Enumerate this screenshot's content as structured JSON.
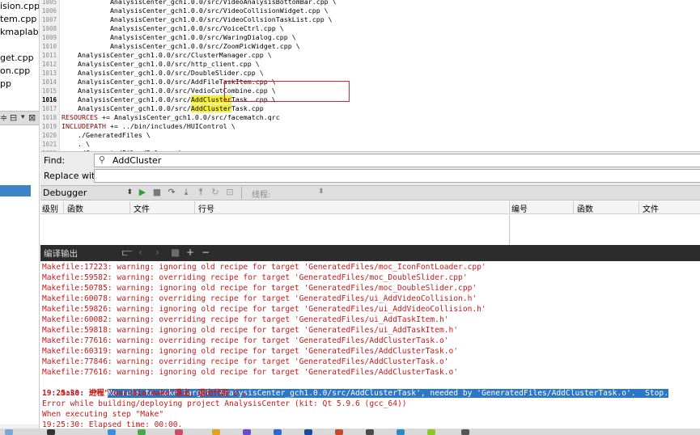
{
  "left_panel": {
    "items": [
      "ision.cpp",
      "tem.cpp",
      "kmaplab",
      "get.cpp",
      "on.cpp",
      "pp"
    ],
    "toolbar_icons": [
      "filter-icon",
      "split-icon",
      "close-icon"
    ]
  },
  "editor": {
    "lines": [
      {
        "num": "1005",
        "text": "            AnalysisCenter_gch1.0.0/src/VideoAnalysisBottomBar.cpp \\"
      },
      {
        "num": "1006",
        "text": "            AnalysisCenter_gch1.0.0/src/VideoCollisionWidget.cpp \\"
      },
      {
        "num": "1007",
        "text": "            AnalysisCenter_gch1.0.0/src/VideoCollsionTaskList.cpp \\"
      },
      {
        "num": "1008",
        "text": "            AnalysisCenter_gch1.0.0/src/VoiceCtrl.cpp \\"
      },
      {
        "num": "1009",
        "text": "            AnalysisCenter_gch1.0.0/src/WaringDialog.cpp \\"
      },
      {
        "num": "1010",
        "text": "            AnalysisCenter_gch1.0.0/src/ZoomPicWidget.cpp \\"
      },
      {
        "num": "1011",
        "text": "    AnalysisCenter_gch1.0.0/src/ClusterManager.cpp \\"
      },
      {
        "num": "1012",
        "text": "    AnalysisCenter_gch1.0.0/src/http_client.cpp \\"
      },
      {
        "num": "1013",
        "text": "    AnalysisCenter_gch1.0.0/src/DoubleSlider.cpp \\"
      },
      {
        "num": "1014",
        "text": "    AnalysisCenter_gch1.0.0/src/AddFileTaskItem.cpp \\"
      },
      {
        "num": "1015",
        "text": "    AnalysisCenter_gch1.0.0/src/VedioCutCombine.cpp \\"
      },
      {
        "num": "1016",
        "pre": "    AnalysisCenter_gch1.0.0/src/",
        "hl": "AddCluster",
        "post": "Task .cpp \\",
        "current": true
      },
      {
        "num": "1017",
        "pre": "    AnalysisCenter_gch1.0.0/src/",
        "hl": "AddCluster",
        "post": "Task.cpp"
      },
      {
        "num": "1018",
        "kw": "RESOURCES",
        "rest": " += AnalysisCenter_gch1.0.0/src/facematch.qrc"
      },
      {
        "num": "1019",
        "kw": "INCLUDEPATH",
        "rest": " += ../bin/includes/HUIControl \\"
      },
      {
        "num": "1020",
        "text": "    ./GeneratedFiles \\"
      },
      {
        "num": "1021",
        "text": "    . \\"
      },
      {
        "num": "1022",
        "text": "    ./GeneratedFiles/Release \\"
      }
    ]
  },
  "find": {
    "find_label": "Find:",
    "find_value": "AddCluster",
    "replace_label": "Replace with:",
    "replace_value": ""
  },
  "debugger": {
    "combo_value": "Debugger",
    "thread_label": "线程:",
    "icons": [
      "continue-icon",
      "stop-icon",
      "step-over-icon",
      "step-into-icon",
      "step-out-icon",
      "restart-icon",
      "reverse-icon"
    ]
  },
  "stack_table": {
    "headers": [
      "级别",
      "函数",
      "文件",
      "行号"
    ]
  },
  "breakpoints_table": {
    "headers": [
      "编号",
      "函数",
      "文件"
    ]
  },
  "output": {
    "title": "编译输出",
    "lines": [
      "Makefile:17223: warning: ignoring old recipe for target 'GeneratedFiles/moc_IconFontLoader.cpp'",
      "Makefile:59582: warning: overriding recipe for target 'GeneratedFiles/moc_DoubleSlider.cpp'",
      "Makefile:50785: warning: ignoring old recipe for target 'GeneratedFiles/moc_DoubleSlider.cpp'",
      "Makefile:60078: warning: overriding recipe for target 'GeneratedFiles/ui_AddVideoCollision.h'",
      "Makefile:59826: warning: ignoring old recipe for target 'GeneratedFiles/ui_AddVideoCollision.h'",
      "Makefile:60082: warning: overriding recipe for target 'GeneratedFiles/ui_AddTaskItem.h'",
      "Makefile:59818: warning: ignoring old recipe for target 'GeneratedFiles/ui_AddTaskItem.h'",
      "Makefile:77616: warning: overriding recipe for target 'GeneratedFiles/AddClusterTask.o'",
      "Makefile:60319: warning: ignoring old recipe for target 'GeneratedFiles/AddClusterTask.o'",
      "Makefile:77846: warning: overriding recipe for target 'GeneratedFiles/AddClusterTask.o'",
      "Makefile:77616: warning: ignoring old recipe for target 'GeneratedFiles/AddClusterTask.o'"
    ],
    "error_prefix": "make: *** ",
    "error_selected": "No rule to make target 'AnalysisCenter_gch1.0.0/src/AddClusterTask', needed by 'GeneratedFiles/AddClusterTask.o'.  Stop.",
    "exit_line": "19:25:30: 进程\"/usr/bin/make\"退出，退出代码 2 。",
    "error_line": "Error while building/deploying project AnalysisCenter (kit: Qt 5.9.6 (gcc_64))",
    "step_line": "When executing step \"Make\"",
    "elapsed_line": "19:25:30: Elapsed time: 00:00."
  },
  "colors": {
    "warning_text": "#c21a1a",
    "selection": "#2d77c8",
    "find_highlight": "#f5f03a",
    "annotation_box": "#e0202a",
    "output_toolbar": "#2c2c2c"
  }
}
